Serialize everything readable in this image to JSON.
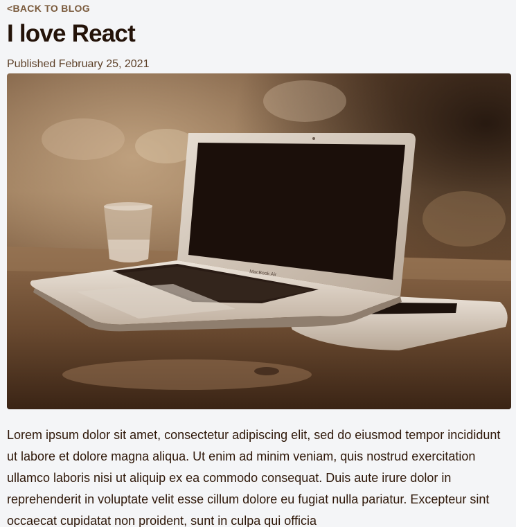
{
  "nav": {
    "back_label": "<BACK TO BLOG"
  },
  "post": {
    "title": "I love React",
    "published": "Published February 25, 2021",
    "hero_image": "laptop-on-wooden-table-photo",
    "body": "Lorem ipsum dolor sit amet, consectetur adipiscing elit, sed do eiusmod tempor incididunt ut labore et dolore magna aliqua. Ut enim ad minim veniam, quis nostrud exercitation ullamco laboris nisi ut aliquip ex ea commodo consequat. Duis aute irure dolor in reprehenderit in voluptate velit esse cillum dolore eu fugiat nulla pariatur. Excepteur sint occaecat cupidatat non proident, sunt in culpa qui officia"
  },
  "colors": {
    "page_background": "#f4f5f7",
    "text": "#2e1708",
    "link": "#7a5a3c"
  }
}
